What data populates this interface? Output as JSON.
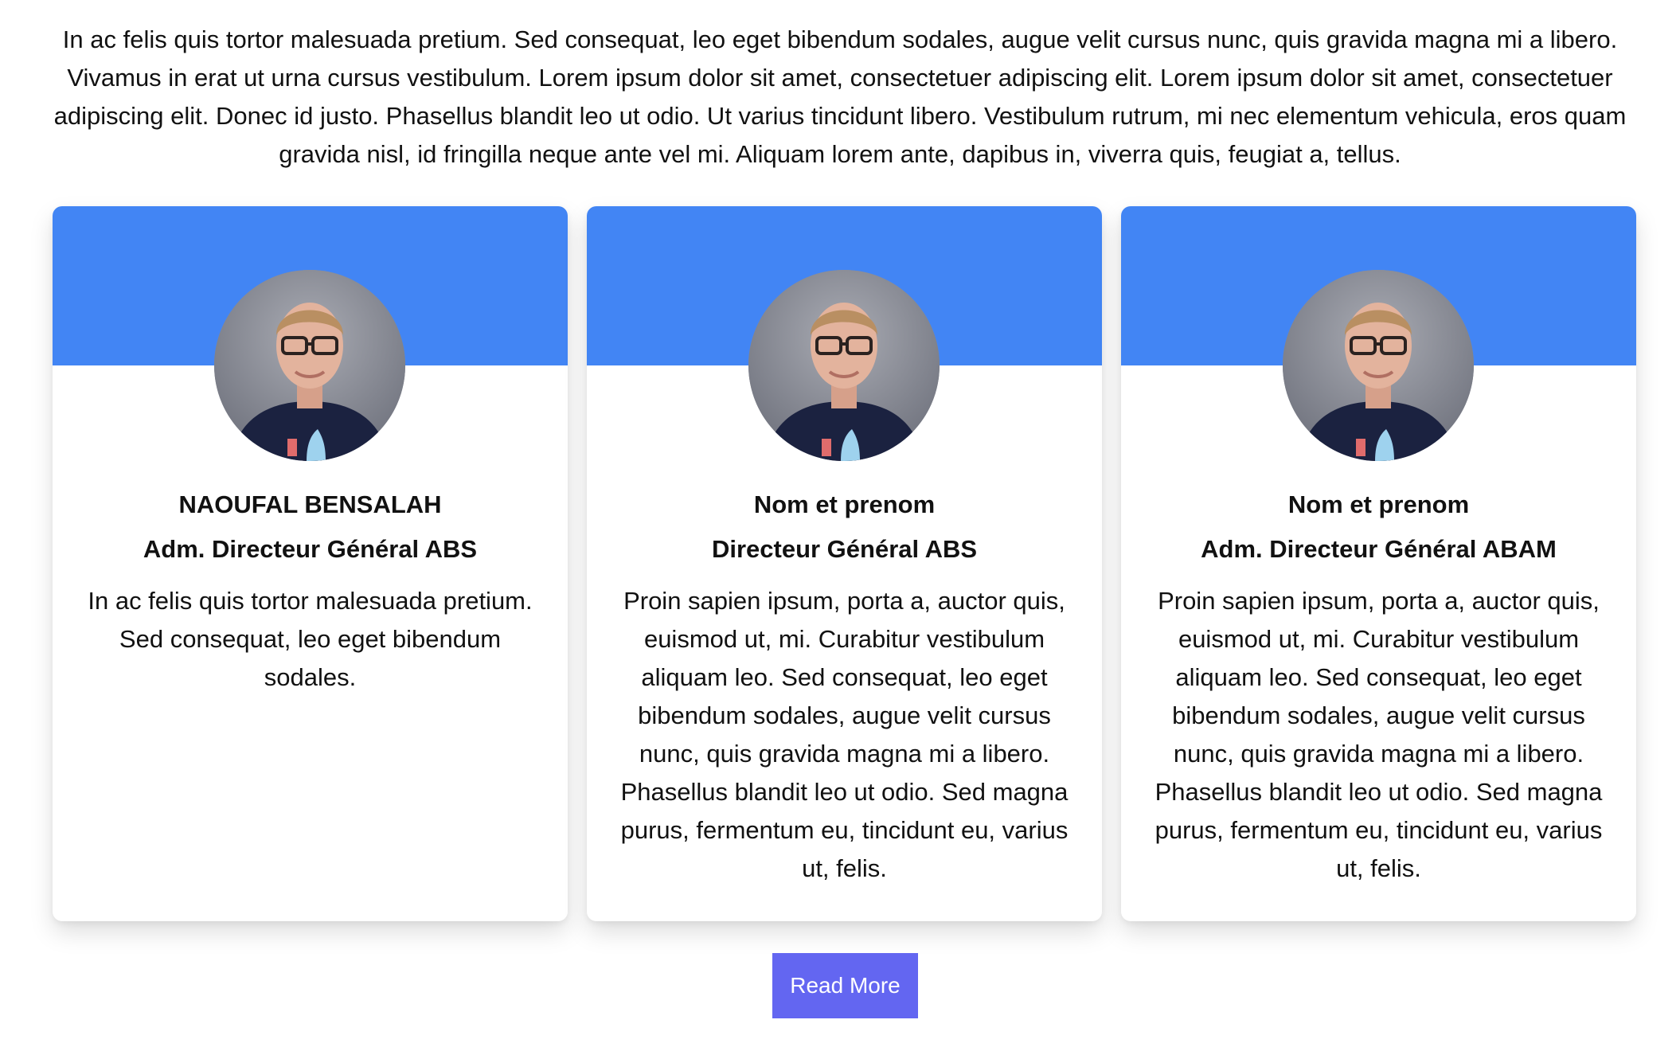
{
  "intro": {
    "text": "In ac felis quis tortor malesuada pretium. Sed consequat, leo eget bibendum sodales, augue velit cursus nunc, quis gravida magna mi a libero. Vivamus in erat ut urna cursus vestibulum. Lorem ipsum dolor sit amet, consectetuer adipiscing elit. Lorem ipsum dolor sit amet, consectetuer adipiscing elit. Donec id justo. Phasellus blandit leo ut odio. Ut varius tincidunt libero. Vestibulum rutrum, mi nec elementum vehicula, eros quam gravida nisl, id fringilla neque ante vel mi. Aliquam lorem ante, dapibus in, viverra quis, feugiat a, tellus."
  },
  "cards": [
    {
      "name": "NAOUFAL BENSALAH",
      "role": "Adm. Directeur Général ABS",
      "text": "In ac felis quis tortor malesuada pretium. Sed consequat, leo eget bibendum sodales."
    },
    {
      "name": "Nom et prenom",
      "role": "Directeur Général ABS",
      "text": "Proin sapien ipsum, porta a, auctor quis, euismod ut, mi. Curabitur vestibulum aliquam leo. Sed consequat, leo eget bibendum sodales, augue velit cursus nunc, quis gravida magna mi a libero. Phasellus blandit leo ut odio. Sed magna purus, fermentum eu, tincidunt eu, varius ut, felis."
    },
    {
      "name": "Nom et prenom",
      "role": "Adm. Directeur Général ABAM",
      "text": "Proin sapien ipsum, porta a, auctor quis, euismod ut, mi. Curabitur vestibulum aliquam leo. Sed consequat, leo eget bibendum sodales, augue velit cursus nunc, quis gravida magna mi a libero. Phasellus blandit leo ut odio. Sed magna purus, fermentum eu, tincidunt eu, varius ut, felis."
    }
  ],
  "read_more": {
    "label": "Read More"
  },
  "colors": {
    "card_banner": "#4285f4",
    "button": "#6366f1",
    "text": "#111111"
  },
  "icons": {
    "avatar": "portrait-photo"
  }
}
